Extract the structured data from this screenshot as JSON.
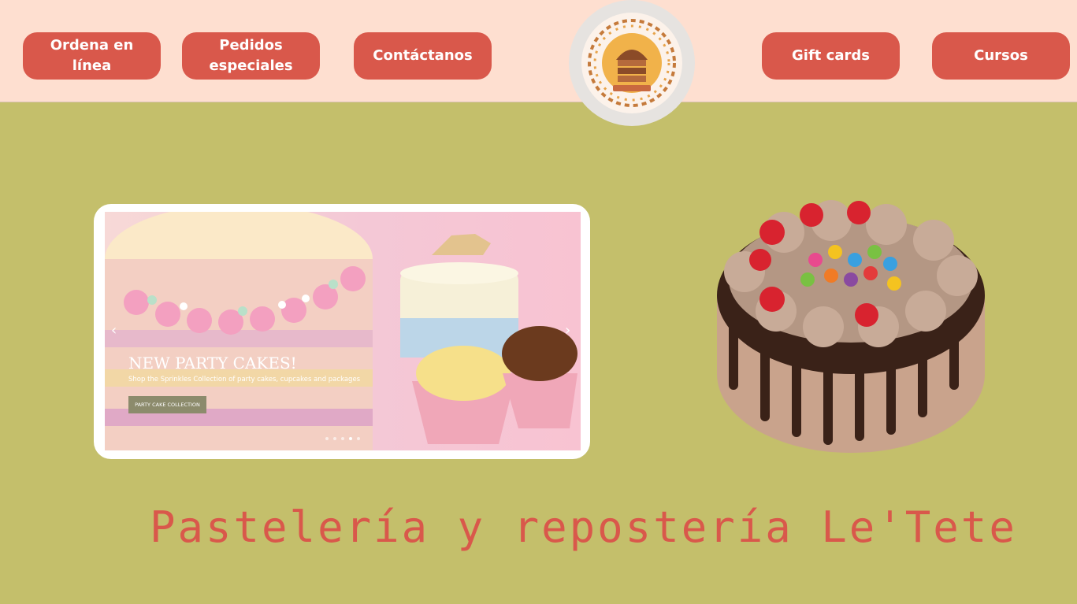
{
  "nav": {
    "order_online": "Ordena en línea",
    "special_orders": "Pedidos especiales",
    "contact": "Contáctanos",
    "gift_cards": "Gift cards",
    "courses": "Cursos"
  },
  "slider": {
    "title": "NEW PARTY CAKES!",
    "subtitle": "Shop the Sprinkles Collection of party cakes, cupcakes and packages",
    "button": "PARTY CAKE COLLECTION",
    "dots_count": 5,
    "active_dot": 4
  },
  "page": {
    "title": "Pastelería y repostería Le'Tete"
  },
  "colors": {
    "header_bg": "#fedfd0",
    "page_bg": "#c4bf6b",
    "accent": "#d9584b"
  }
}
